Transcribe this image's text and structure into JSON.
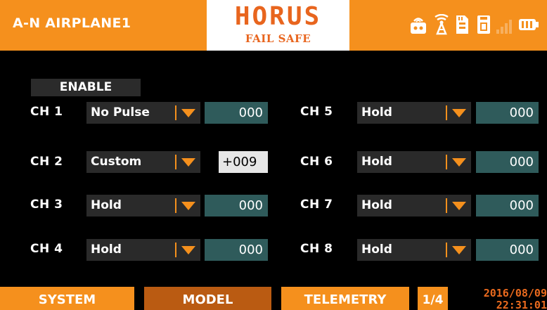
{
  "header": {
    "model_name": "A-N AIRPLANE1",
    "logo_title": "HORUS",
    "logo_subtitle": "FAIL SAFE"
  },
  "status_icons": [
    "radio-transmitter-icon",
    "antenna-signal-icon",
    "sd-card-icon",
    "memory-icon",
    "rssi-bars-icon",
    "battery-icon"
  ],
  "enable_label": "ENABLE",
  "channels": [
    {
      "label": "CH 1",
      "mode": "No Pulse",
      "value": "000"
    },
    {
      "label": "CH 2",
      "mode": "Custom",
      "value": "+009"
    },
    {
      "label": "CH 3",
      "mode": "Hold",
      "value": "000"
    },
    {
      "label": "CH 4",
      "mode": "Hold",
      "value": "000"
    },
    {
      "label": "CH 5",
      "mode": "Hold",
      "value": "000"
    },
    {
      "label": "CH 6",
      "mode": "Hold",
      "value": "000"
    },
    {
      "label": "CH 7",
      "mode": "Hold",
      "value": "000"
    },
    {
      "label": "CH 8",
      "mode": "Hold",
      "value": "000"
    }
  ],
  "footer": {
    "tabs": [
      {
        "label": "SYSTEM"
      },
      {
        "label": "MODEL"
      },
      {
        "label": "TELEMETRY"
      }
    ],
    "active_tab": "MODEL",
    "page": "1/4",
    "date": "2016/08/09",
    "time": "22:31:01"
  },
  "colors": {
    "accent": "#f5901d",
    "accent_dark": "#ba5b12",
    "logo": "#e8651e",
    "value_bg": "#2f5b5b",
    "field_bg": "#2a2a2a",
    "background": "#000000"
  }
}
